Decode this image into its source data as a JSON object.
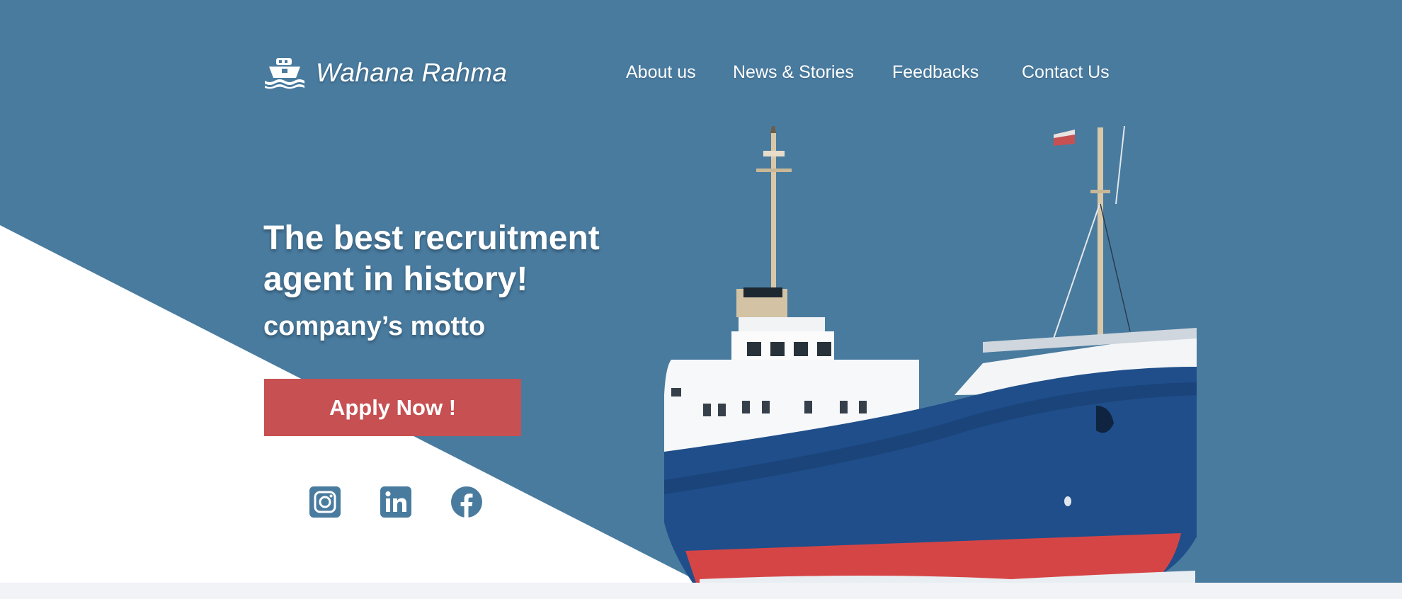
{
  "brand": {
    "name": "Wahana Rahma",
    "icon": "ship-icon"
  },
  "nav": {
    "items": [
      {
        "label": "About us"
      },
      {
        "label": "News & Stories"
      },
      {
        "label": "Feedbacks"
      },
      {
        "label": "Contact Us"
      }
    ]
  },
  "hero": {
    "headline": "The best recruitment agent in history!",
    "motto": "company’s motto",
    "cta_label": "Apply Now !",
    "image": "cargo-ship-image"
  },
  "social": [
    {
      "icon": "instagram-icon"
    },
    {
      "icon": "linkedin-icon"
    },
    {
      "icon": "facebook-icon"
    }
  ],
  "colors": {
    "primary": "#497b9f",
    "accent": "#c65052",
    "text": "#ffffff",
    "page_bg": "#f1f3f7"
  }
}
